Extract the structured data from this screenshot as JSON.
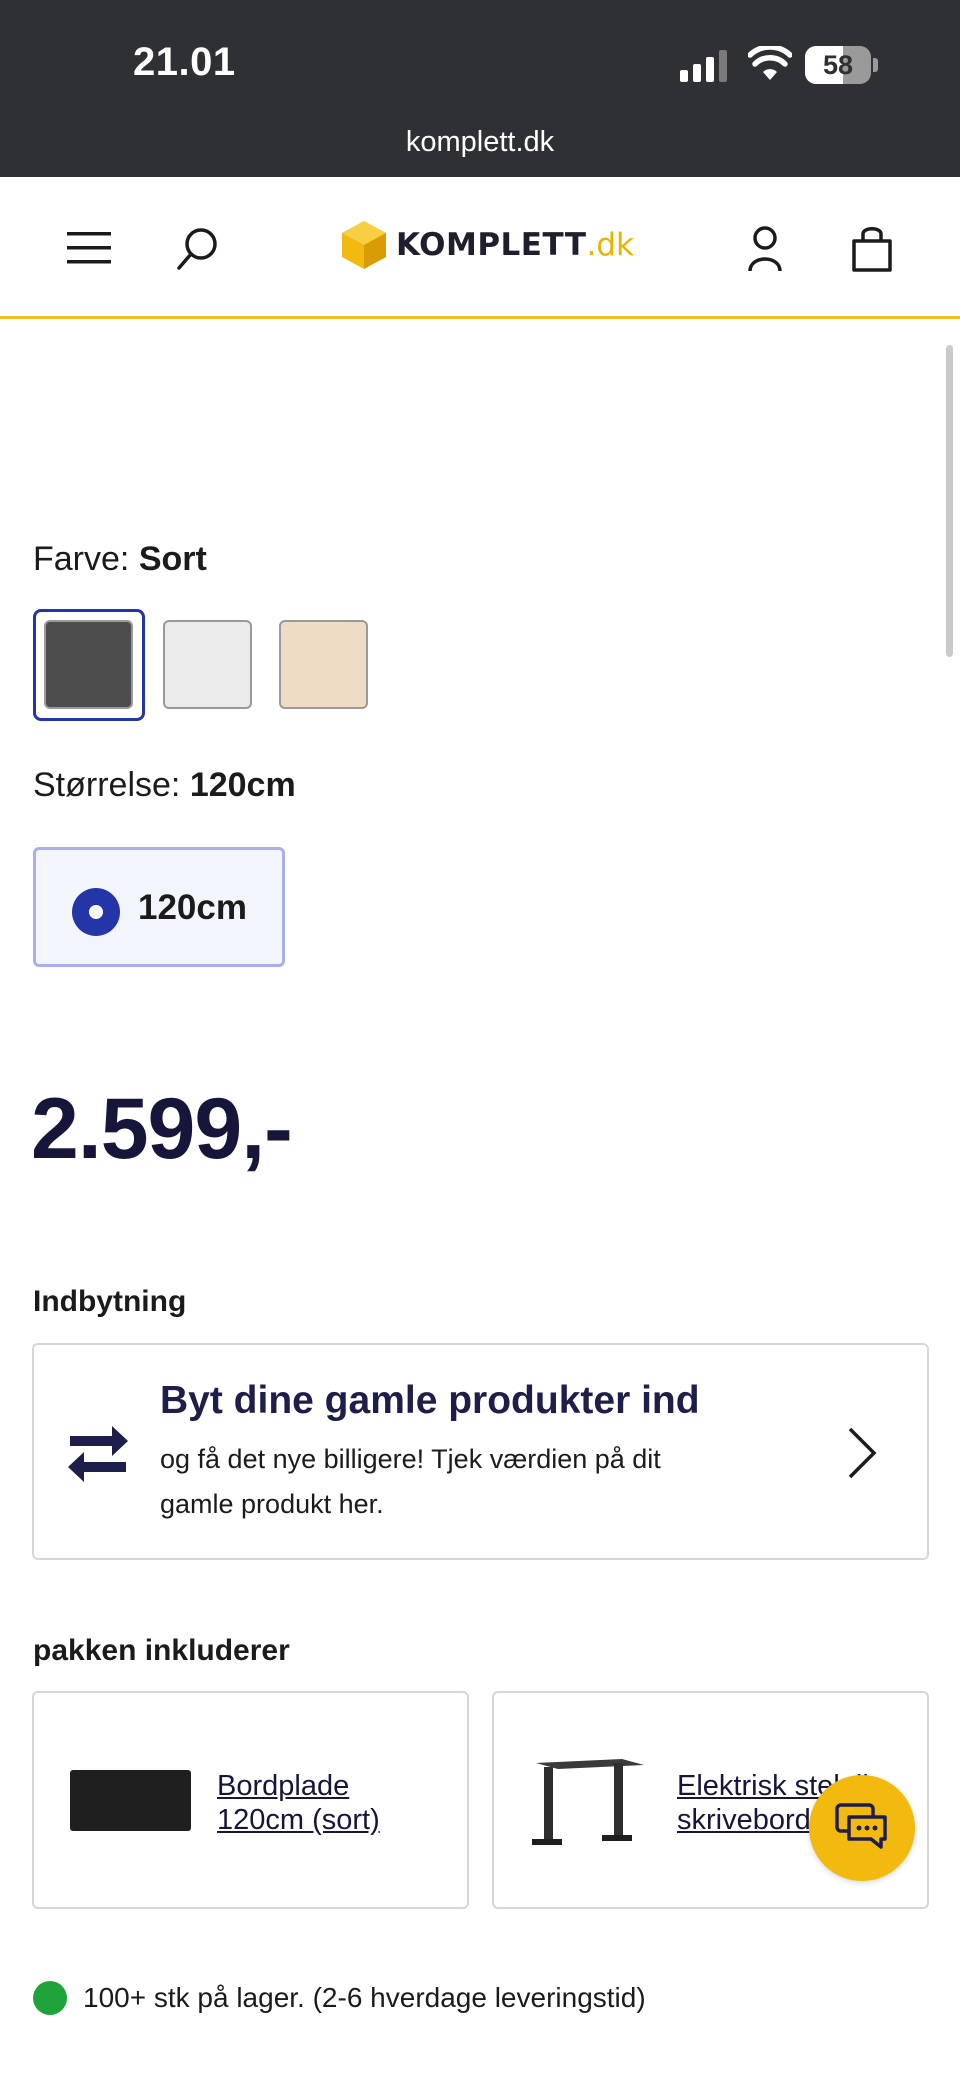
{
  "status_bar": {
    "time": "21.01",
    "battery": "58",
    "battery_level": 0.58,
    "url": "komplett.dk"
  },
  "header": {
    "logo_text": "KOMPLETT",
    "logo_tld": ".dk",
    "icons": [
      "menu-icon",
      "search-icon",
      "account-icon",
      "cart-icon"
    ]
  },
  "options": {
    "color_label": "Farve:",
    "color_value": "Sort",
    "colors": [
      "#4d4d4d",
      "#ebebeb",
      "#efdcc4"
    ],
    "size_label": "Størrelse:",
    "size_value": "120cm",
    "size_option": "120cm"
  },
  "price": "2.599,-",
  "trade_in": {
    "section": "Indbytning",
    "title": "Byt dine gamle produkter ind",
    "description": "og få det nye billigere! Tjek værdien på dit gamle produkt her."
  },
  "package": {
    "section": "pakken inkluderer",
    "items": [
      {
        "name": "Bordplade 120cm (sort)"
      },
      {
        "name": "Elektrisk stel til skrivebord"
      }
    ]
  },
  "stock": {
    "text": "100+ stk på lager. (2-6 hverdage leveringstid)",
    "status_color": "#1fa33a"
  },
  "accent_color": "#2435a8",
  "brand_color": "#f2b90f"
}
